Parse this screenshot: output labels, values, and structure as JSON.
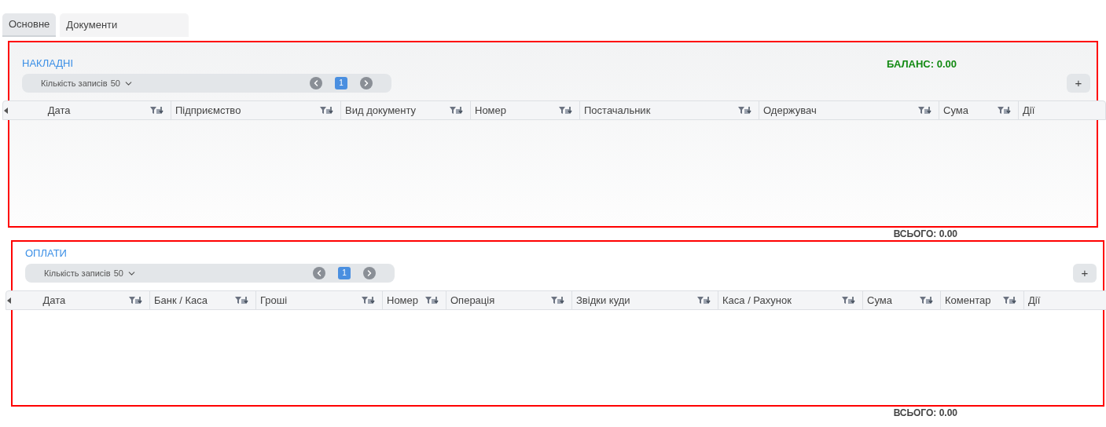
{
  "tabs": [
    {
      "label": "Основне",
      "selected": true
    },
    {
      "label": "Документи",
      "selected": false
    }
  ],
  "sections": [
    {
      "title": "НАКЛАДНІ",
      "balance": "БАЛАНС: 0.00",
      "page_size_label": "Кількість записів",
      "page_size": "50",
      "page": "1",
      "add": "+",
      "total": "ВСЬОГО: 0.00",
      "columns": [
        {
          "label": "Дата",
          "filter": true
        },
        {
          "label": "Підприємство",
          "filter": true
        },
        {
          "label": "Вид документу",
          "filter": true
        },
        {
          "label": "Номер",
          "filter": true
        },
        {
          "label": "Постачальник",
          "filter": true
        },
        {
          "label": "Одержувач",
          "filter": true
        },
        {
          "label": "Сума",
          "filter": true
        },
        {
          "label": "Дії",
          "filter": false
        }
      ]
    },
    {
      "title": "ОПЛАТИ",
      "page_size_label": "Кількість записів",
      "page_size": "50",
      "page": "1",
      "add": "+",
      "total": "ВСЬОГО: 0.00",
      "columns": [
        {
          "label": "Дата",
          "filter": true
        },
        {
          "label": "Банк / Каса",
          "filter": true
        },
        {
          "label": "Гроші",
          "filter": true
        },
        {
          "label": "Номер",
          "filter": true
        },
        {
          "label": "Операція",
          "filter": true
        },
        {
          "label": "Звідки куди",
          "filter": true
        },
        {
          "label": "Каса / Рахунок",
          "filter": true
        },
        {
          "label": "Сума",
          "filter": true
        },
        {
          "label": "Коментар",
          "filter": true
        },
        {
          "label": "Дії",
          "filter": false
        }
      ]
    }
  ]
}
